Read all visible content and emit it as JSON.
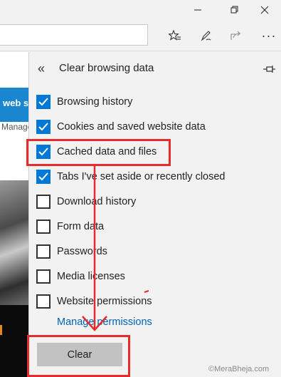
{
  "browser": {
    "page_strip": {
      "banner_text": "web s",
      "manage_text": "Manage"
    },
    "toolbar_icons": [
      "favorites-star-icon",
      "pen-icon",
      "share-icon",
      "more-icon"
    ],
    "window_icons": [
      "minimize-icon",
      "restore-icon",
      "close-icon"
    ]
  },
  "panel": {
    "title": "Clear browsing data",
    "options": [
      {
        "label": "Browsing history",
        "checked": true
      },
      {
        "label": "Cookies and saved website data",
        "checked": true
      },
      {
        "label": "Cached data and files",
        "checked": true
      },
      {
        "label": "Tabs I've set aside or recently closed",
        "checked": true
      },
      {
        "label": "Download history",
        "checked": false
      },
      {
        "label": "Form data",
        "checked": false
      },
      {
        "label": "Passwords",
        "checked": false
      },
      {
        "label": "Media licenses",
        "checked": false
      },
      {
        "label": "Website permissions",
        "checked": false
      }
    ],
    "manage_permissions_link": "Manage permissions",
    "clear_button": "Clear"
  },
  "colors": {
    "checkbox_checked": "#0078d7",
    "link": "#0063b1",
    "annotation": "#e52c2c"
  },
  "watermark": "©MeraBheja.com"
}
